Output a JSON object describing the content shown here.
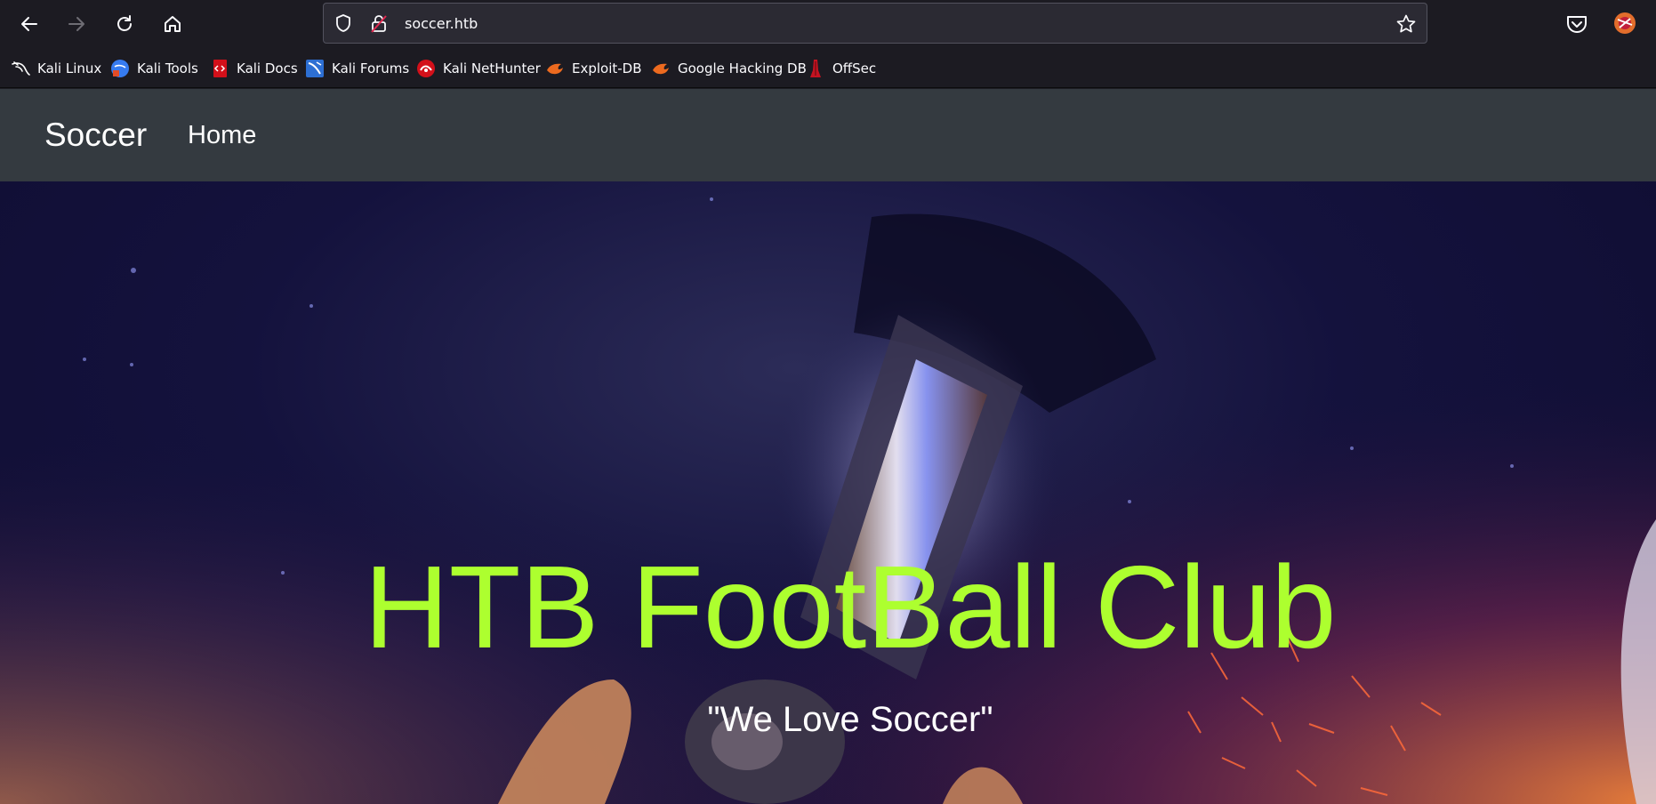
{
  "browser": {
    "url": "soccer.htb",
    "nav": {
      "back": "back-arrow",
      "forward": "forward-arrow",
      "reload": "reload",
      "home": "home"
    }
  },
  "bookmarks": [
    {
      "label": "Kali Linux",
      "icon": "kali-dragon-icon"
    },
    {
      "label": "Kali Tools",
      "icon": "kali-tools-icon"
    },
    {
      "label": "Kali Docs",
      "icon": "kali-docs-icon"
    },
    {
      "label": "Kali Forums",
      "icon": "kali-forums-icon"
    },
    {
      "label": "Kali NetHunter",
      "icon": "kali-nethunter-icon"
    },
    {
      "label": "Exploit-DB",
      "icon": "exploit-db-icon"
    },
    {
      "label": "Google Hacking DB",
      "icon": "ghdb-icon"
    },
    {
      "label": "OffSec",
      "icon": "offsec-icon"
    }
  ],
  "site": {
    "brand": "Soccer",
    "nav_home": "Home",
    "hero_title": "HTB FootBall Club",
    "hero_subtitle": "\"We Love Soccer\""
  },
  "colors": {
    "title": "#adff2f",
    "navbar": "#343a40"
  }
}
